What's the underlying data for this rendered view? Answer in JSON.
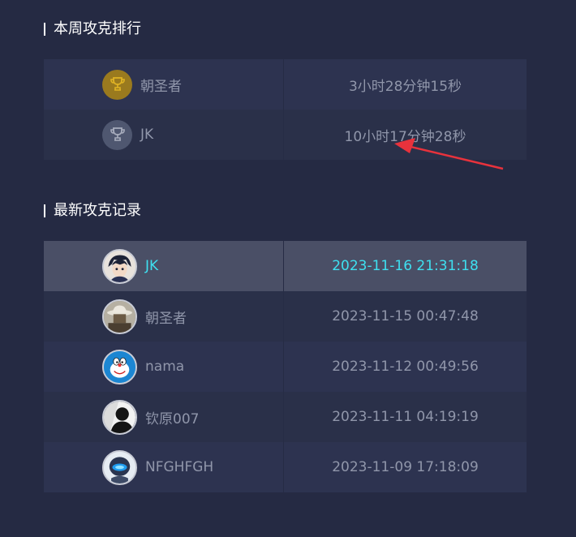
{
  "weekly_ranking": {
    "title": "本周攻克排行",
    "rows": [
      {
        "name": "朝圣者",
        "time": "3小时28分钟15秒",
        "badge": "gold-trophy-icon"
      },
      {
        "name": "JK",
        "time": "10小时17分钟28秒",
        "badge": "silver-trophy-icon"
      }
    ]
  },
  "latest_records": {
    "title": "最新攻克记录",
    "rows": [
      {
        "name": "JK",
        "datetime": "2023-11-16 21:31:18",
        "avatar": "anime-boy-avatar",
        "highlight": true
      },
      {
        "name": "朝圣者",
        "datetime": "2023-11-15 00:47:48",
        "avatar": "cowboy-hat-avatar"
      },
      {
        "name": "nama",
        "datetime": "2023-11-12 00:49:56",
        "avatar": "doraemon-avatar"
      },
      {
        "name": "钦原007",
        "datetime": "2023-11-11 04:19:19",
        "avatar": "silhouette-avatar"
      },
      {
        "name": "NFGHFGH",
        "datetime": "2023-11-09 17:18:09",
        "avatar": "robot-helmet-avatar"
      }
    ]
  },
  "colors": {
    "background": "#252a43",
    "highlight_text": "#3ee0f0",
    "annotation_arrow": "#e8323c",
    "gold": "#e0b324"
  }
}
